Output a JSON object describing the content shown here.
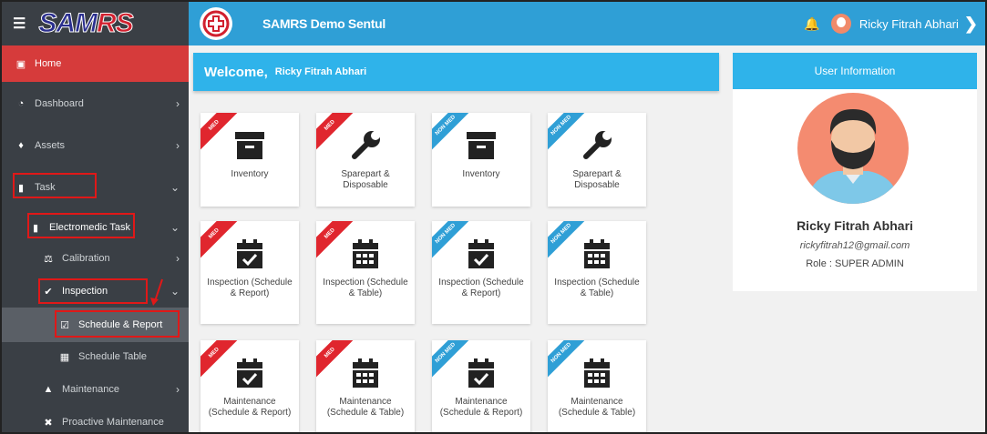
{
  "brand": {
    "logo_a": "SAM",
    "logo_b": "RS"
  },
  "topbar": {
    "title": "SAMRS Demo Sentul",
    "user": "Ricky Fitrah Abhari"
  },
  "sidebar": {
    "items": [
      {
        "label": "Home"
      },
      {
        "label": "Dashboard"
      },
      {
        "label": "Assets"
      },
      {
        "label": "Task"
      },
      {
        "label": "Electromedic Task"
      },
      {
        "label": "Calibration"
      },
      {
        "label": "Inspection"
      },
      {
        "label": "Schedule & Report"
      },
      {
        "label": "Schedule Table"
      },
      {
        "label": "Maintenance"
      },
      {
        "label": "Proactive Maintenance"
      }
    ]
  },
  "welcome": {
    "greeting": "Welcome,",
    "name": "Ricky Fitrah Abhari"
  },
  "tiles": [
    {
      "ribbon": "MED",
      "label": "Inventory"
    },
    {
      "ribbon": "MED",
      "label": "Sparepart & Disposable"
    },
    {
      "ribbon": "NON MED",
      "label": "Inventory"
    },
    {
      "ribbon": "NON MED",
      "label": "Sparepart & Disposable"
    },
    {
      "ribbon": "MED",
      "label": "Inspection (Schedule & Report)"
    },
    {
      "ribbon": "MED",
      "label": "Inspection (Schedule & Table)"
    },
    {
      "ribbon": "NON MED",
      "label": "Inspection (Schedule & Report)"
    },
    {
      "ribbon": "NON MED",
      "label": "Inspection (Schedule & Table)"
    },
    {
      "ribbon": "MED",
      "label": "Maintenance (Schedule & Report)"
    },
    {
      "ribbon": "MED",
      "label": "Maintenance (Schedule & Table)"
    },
    {
      "ribbon": "NON MED",
      "label": "Maintenance (Schedule & Report)"
    },
    {
      "ribbon": "NON MED",
      "label": "Maintenance (Schedule & Table)"
    }
  ],
  "user_info": {
    "header": "User Information",
    "name": "Ricky Fitrah Abhari",
    "email": "rickyfitrah12@gmail.com",
    "role": "Role : SUPER ADMIN"
  },
  "colors": {
    "sidebar": "#3a3f45",
    "accent": "#2f9fd6",
    "med": "#e0262e",
    "home": "#d63b3b"
  }
}
